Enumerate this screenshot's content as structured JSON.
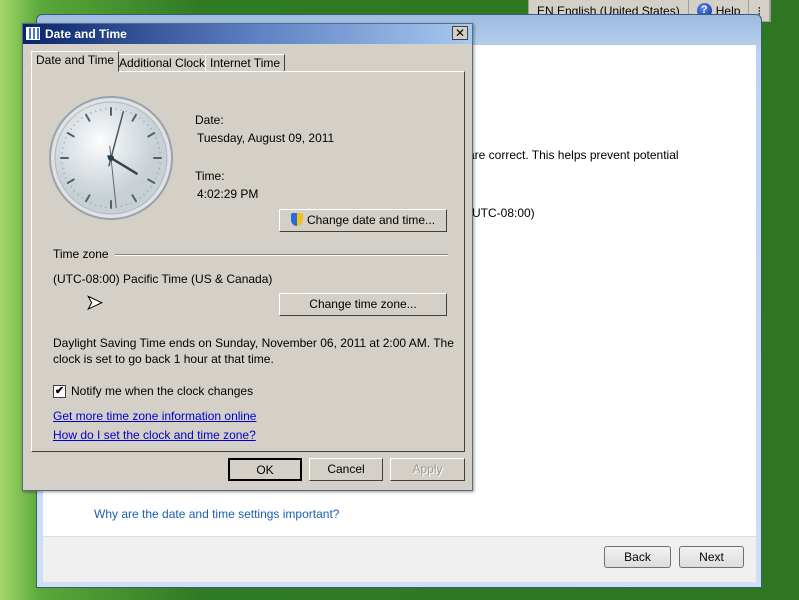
{
  "language_bar": {
    "language": "EN English (United States)",
    "help": "Help"
  },
  "setup": {
    "text_line1": "are correct. This helps prevent potential",
    "text_line2": "(UTC-08:00)",
    "why_link": "Why are the date and time settings important?",
    "back": "Back",
    "next": "Next"
  },
  "dialog": {
    "title": "Date and Time",
    "tabs": [
      {
        "label": "Date and Time",
        "active": true
      },
      {
        "label": "Additional Clocks"
      },
      {
        "label": "Internet Time"
      }
    ],
    "date_label": "Date:",
    "date_value": "Tuesday, August 09, 2011",
    "time_label": "Time:",
    "time_value": "4:02:29 PM",
    "change_datetime": "Change date and time...",
    "timezone_group": "Time zone",
    "timezone_value": "(UTC-08:00) Pacific Time (US & Canada)",
    "change_timezone": "Change time zone...",
    "dst_line1": "Daylight Saving Time ends on Sunday, November 06, 2011 at 2:00 AM. The",
    "dst_line2": "clock is set to go back 1 hour at that time.",
    "notify_label": "Notify me when the clock changes",
    "notify_checked": true,
    "link1": "Get more time zone information online",
    "link2": "How do I set the clock and time zone?",
    "ok": "OK",
    "cancel": "Cancel",
    "apply": "Apply"
  },
  "clock": {
    "hour": 4,
    "minute": 2,
    "second": 29
  }
}
